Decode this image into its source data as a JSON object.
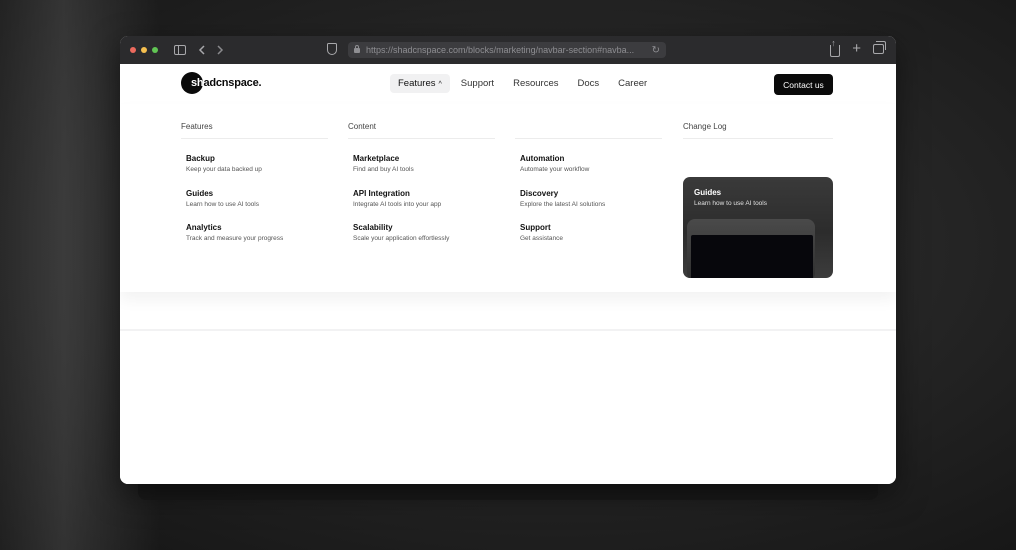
{
  "browser": {
    "traffic_lights": [
      "#ec6a5e",
      "#f5bf4f",
      "#61c554"
    ],
    "url": "https://shadcnspace.com/blocks/marketing/navbar-section#navba..."
  },
  "site": {
    "logo_first": "sh",
    "logo_rest": "adcnspace.",
    "nav": [
      {
        "label": "Features",
        "active": true
      },
      {
        "label": "Support"
      },
      {
        "label": "Resources"
      },
      {
        "label": "Docs"
      },
      {
        "label": "Career"
      }
    ],
    "contact_label": "Contact us"
  },
  "mega": {
    "columns": [
      {
        "title": "Features",
        "items": [
          {
            "title": "Backup",
            "desc": "Keep your data backed up"
          },
          {
            "title": "Guides",
            "desc": "Learn how to use AI tools"
          },
          {
            "title": "Analytics",
            "desc": "Track and measure your progress"
          }
        ]
      },
      {
        "title": "Content",
        "items": [
          {
            "title": "Marketplace",
            "desc": "Find and buy AI tools"
          },
          {
            "title": "API Integration",
            "desc": "Integrate AI tools into your app"
          },
          {
            "title": "Scalability",
            "desc": "Scale your application effortlessly"
          }
        ]
      },
      {
        "title": "",
        "items": [
          {
            "title": "Automation",
            "desc": "Automate your workflow"
          },
          {
            "title": "Discovery",
            "desc": "Explore the latest AI solutions"
          },
          {
            "title": "Support",
            "desc": "Get assistance"
          }
        ]
      }
    ],
    "changelog": {
      "title": "Change Log",
      "card_title": "Guides",
      "card_desc": "Learn how to use AI tools"
    }
  }
}
